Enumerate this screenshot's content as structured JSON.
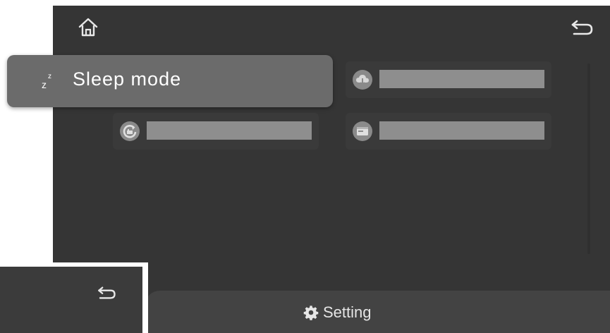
{
  "header": {
    "home_icon": "home-icon",
    "back_icon": "back-icon"
  },
  "menu": {
    "selected_item_label": "Sleep mode",
    "selected_item_icon": "moon-sleep-icon",
    "tiles": [
      {
        "icon": "cloud-download-icon"
      },
      {
        "icon": "refresh-factory-icon"
      },
      {
        "icon": "display-window-icon"
      }
    ]
  },
  "footer": {
    "title": "Setting",
    "icon": "gear-icon"
  },
  "inset": {
    "back_icon": "back-icon"
  },
  "colors": {
    "screen_bg": "#353535",
    "highlight_bg": "#6b6b6b",
    "tile_bar": "#8e8e8e",
    "text": "#ffffff"
  }
}
